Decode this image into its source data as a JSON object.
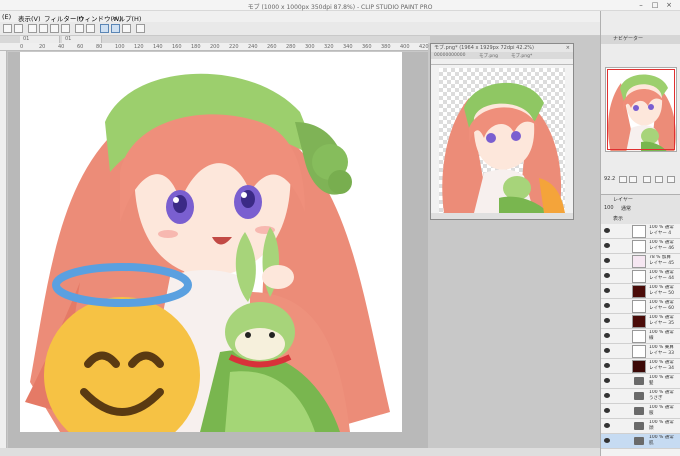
{
  "window": {
    "title": "モブ (1000 x 1000px 350dpi 87.8%) - CLIP STUDIO PAINT PRO",
    "min_glyph": "–",
    "max_glyph": "□",
    "close_glyph": "×"
  },
  "menu": [
    "(E)",
    "表示(V)",
    "フィルター(I)",
    "ウィンドウ(W)",
    "ヘルプ(H)"
  ],
  "doc_tabs": [
    "01",
    "01"
  ],
  "ruler_ticks": [
    "0",
    "20",
    "40",
    "60",
    "80",
    "100",
    "120",
    "140",
    "160",
    "180",
    "200",
    "220",
    "240",
    "260",
    "280",
    "300",
    "320",
    "340",
    "360",
    "380",
    "400",
    "420"
  ],
  "subwindow": {
    "title": "モブ.png* (1964 x 1929px 72dpi 42.2%)",
    "tabs": [
      "00000000000",
      "モブ.png",
      "モブ.png*"
    ],
    "close_glyph": "×"
  },
  "right_panel": {
    "header": "ナビゲーター",
    "zoom": "92.2",
    "angle": "0.0"
  },
  "layer_panel": {
    "header": "レイヤー",
    "blend_mode": "通常",
    "opacity": "100",
    "display_label": "表示"
  },
  "layers": [
    {
      "name": "100 % 通常\nレイヤー 4",
      "thumb": "#ffffff",
      "type": "layer"
    },
    {
      "name": "100 % 通常\nレイヤー 46",
      "thumb": "#ffffff",
      "type": "layer"
    },
    {
      "name": "78 % 加算\nレイヤー 45",
      "thumb": "#f6e7f2",
      "type": "layer"
    },
    {
      "name": "100 % 通常\nレイヤー 44",
      "thumb": "#ffffff",
      "type": "layer"
    },
    {
      "name": "100 % 通常\nレイヤー 50",
      "thumb": "#4a0b08",
      "type": "layer"
    },
    {
      "name": "100 % 通常\nレイヤー 60",
      "thumb": "#ffffff",
      "type": "layer"
    },
    {
      "name": "100 % 通常\nレイヤー 35",
      "thumb": "#4a0b08",
      "type": "layer"
    },
    {
      "name": "100 % 通常\n線",
      "thumb": "#ffffff",
      "type": "layer"
    },
    {
      "name": "100 % 乗算\nレイヤー 33",
      "thumb": "#ffffff",
      "type": "layer"
    },
    {
      "name": "100 % 通常\nレイヤー 34",
      "thumb": "#3b0806",
      "type": "layer"
    },
    {
      "name": "100 % 通常\n髪",
      "thumb": "#ffffff",
      "type": "folder"
    },
    {
      "name": "100 % 通常\nうさぎ",
      "thumb": "#ffffff",
      "type": "folder"
    },
    {
      "name": "100 % 通常\n服",
      "thumb": "#ffffff",
      "type": "folder"
    },
    {
      "name": "100 % 通常\n顔",
      "thumb": "#ffffff",
      "type": "folder"
    },
    {
      "name": "100 % 通常\n肌",
      "thumb": "#ffffff",
      "type": "folder"
    }
  ]
}
